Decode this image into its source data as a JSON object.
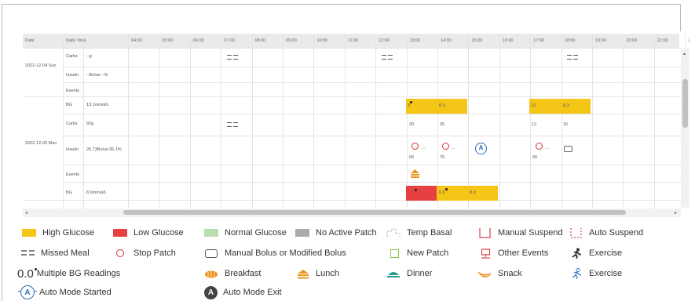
{
  "colors": {
    "high": "#f5c518",
    "low": "#e74040",
    "normal": "#b9dcb0",
    "no_active": "#aaaaaa",
    "accent_blue": "#2d6bb5",
    "stop_red": "#e03030",
    "event_red": "#d84444",
    "snack_orange": "#e89018"
  },
  "table": {
    "header": {
      "date": "Date",
      "daily_total": "Daily Total",
      "hours": [
        "04:00",
        "05:00",
        "06:00",
        "07:00",
        "08:00",
        "09:00",
        "10:00",
        "11:00",
        "12:00",
        "13:00",
        "14:00",
        "15:00",
        "16:00",
        "17:00",
        "18:00",
        "19:00",
        "20:00",
        "21:00",
        "2"
      ]
    },
    "days": [
      {
        "date": "2022-12-04 Sun",
        "rows": [
          {
            "label": "Carbs",
            "total": "--g"
          },
          {
            "label": "Insulin",
            "total": "--Bolus:--%"
          },
          {
            "label": "Events",
            "total": ""
          }
        ]
      },
      {
        "date": "2022-12-05 Mon",
        "rows": [
          {
            "label": "BG",
            "total": "13.1mmol/L"
          },
          {
            "label": "Carbs",
            "total": "92g"
          },
          {
            "label": "Insulin",
            "total": "26.73Bolus:35.1%"
          },
          {
            "label": "Events",
            "total": ""
          },
          {
            "label": "BG",
            "total": "8.0mmol/L"
          }
        ]
      }
    ],
    "cells": {
      "bg1_13": "9",
      "bg1_14": "8.3",
      "bg1_17": "13",
      "bg1_18": "8.3",
      "carbs_13": "30",
      "carbs_14": "35",
      "carbs_17": "12",
      "carbs_18": "15",
      "ins_13": "05",
      "ins_14": "75",
      "ins_17": "90",
      "bg2_14": "6.5",
      "bg2_15": "8.0",
      "dots": "..."
    }
  },
  "legend": [
    {
      "icon": "high-glucose-swatch",
      "label": "High Glucose"
    },
    {
      "icon": "low-glucose-swatch",
      "label": "Low Glucose"
    },
    {
      "icon": "normal-glucose-swatch",
      "label": "Normal Glucose"
    },
    {
      "icon": "no-active-patch-swatch",
      "label": "No Active Patch"
    },
    {
      "icon": "temp-basal-icon",
      "label": "Temp Basal"
    },
    {
      "icon": "manual-suspend-icon",
      "label": "Manual Suspend"
    },
    {
      "icon": "auto-suspend-icon",
      "label": "Auto Suspend"
    },
    {
      "icon": "missed-meal-icon",
      "label": "Missed Meal"
    },
    {
      "icon": "stop-patch-icon",
      "label": "Stop Patch"
    },
    {
      "icon": "manual-bolus-icon",
      "label": "Manual Bolus or Modified Bolus"
    },
    {
      "icon": "new-patch-icon",
      "label": "New Patch"
    },
    {
      "icon": "other-events-icon",
      "label": "Other Events"
    },
    {
      "icon": "exercise-icon",
      "label": "Exercise"
    },
    {
      "icon": "multiple-bg-icon",
      "label": "Multiple BG Readings",
      "glyph": "0.0"
    },
    {
      "icon": "breakfast-icon",
      "label": "Breakfast"
    },
    {
      "icon": "lunch-icon",
      "label": "Lunch"
    },
    {
      "icon": "dinner-icon",
      "label": "Dinner"
    },
    {
      "icon": "snack-icon",
      "label": "Snack"
    },
    {
      "icon": "exercise-alt-icon",
      "label": "Exercise"
    },
    {
      "icon": "auto-mode-started-icon",
      "label": "Auto Mode Started",
      "glyph": "A"
    },
    {
      "icon": "auto-mode-exit-icon",
      "label": "Auto Mode Exit",
      "glyph": "A"
    }
  ]
}
